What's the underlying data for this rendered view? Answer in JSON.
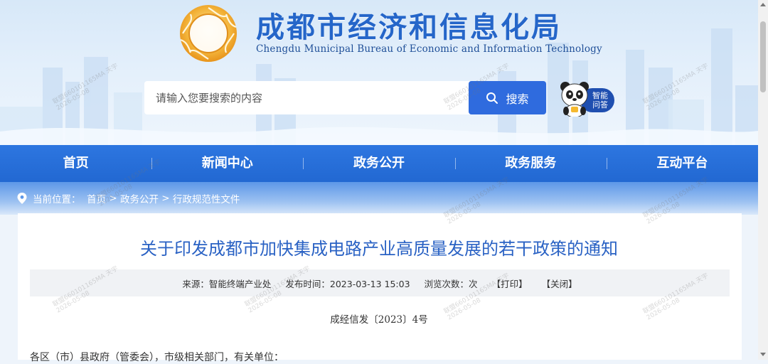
{
  "header": {
    "title": "成都市经济和信息化局",
    "subtitle": "Chengdu Municipal Bureau of Economic and Information Technology"
  },
  "search": {
    "placeholder": "请输入您要搜索的内容",
    "button_label": "搜索"
  },
  "qa_widget": {
    "line1": "智能",
    "line2": "问答"
  },
  "nav": {
    "items": [
      {
        "label": "首页"
      },
      {
        "label": "新闻中心"
      },
      {
        "label": "政务公开"
      },
      {
        "label": "政务服务"
      },
      {
        "label": "互动平台"
      }
    ]
  },
  "breadcrumb": {
    "prefix": "当前位置：",
    "items": [
      {
        "label": "首页"
      },
      {
        "label": "政务公开"
      },
      {
        "label": "行政规范性文件"
      }
    ],
    "separator": ">"
  },
  "article": {
    "title": "关于印发成都市加快集成电路产业高质量发展的若干政策的通知",
    "source": "来源：智能终端产业处",
    "published": "发布时间：2023-03-13 15:03",
    "views": "浏览次数：次",
    "print_label": "【打印】",
    "close_label": "【关闭】",
    "doc_number": "成经信发〔2023〕4号",
    "addressee": "各区（市）县政府（管委会），市级相关部门，有关单位："
  },
  "watermark": {
    "text": "联盟660101165MA 天宇",
    "date": "2026-05-08"
  },
  "colors": {
    "brand_blue": "#2566c9",
    "nav_blue": "#2268d2",
    "title_blue": "#2a62c4",
    "search_button": "#2f6bde"
  }
}
